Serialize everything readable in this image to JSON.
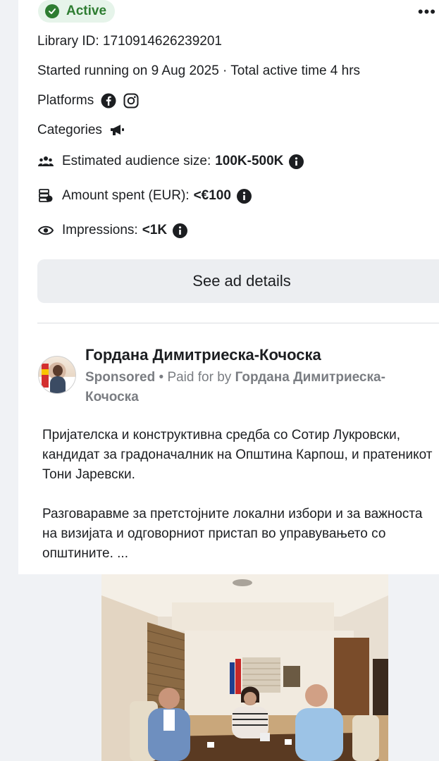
{
  "ad": {
    "status": "Active",
    "library_id": "Library ID: 1710914626239201",
    "running": "Started running on 9 Aug 2025 · Total active time 4 hrs",
    "platforms_label": "Platforms",
    "platforms": [
      "facebook-icon",
      "instagram-icon"
    ],
    "categories_label": "Categories",
    "categories": [
      "megaphone-icon"
    ],
    "audience_label": "Estimated audience size:",
    "audience_value": "100K-500K",
    "spent_label": "Amount spent (EUR):",
    "spent_value": "<€100",
    "impressions_label": "Impressions:",
    "impressions_value": "<1K",
    "see_details": "See ad details"
  },
  "post": {
    "advertiser": "Гордана Димитриеска-Кочоска",
    "sponsored": "Sponsored",
    "paid_for_by": " • Paid for by ",
    "payer": "Гордана Димитриеска-Кочоска",
    "paragraph1": "Пријателска и конструктивна  средба со Сотир Лукровски, кандидат за градоначалник на Општина Карпош, и пратеникот Тони Јаревски.",
    "paragraph2": "Разговаравме за претстојните локални избори и за важноста на визијата и одговорниот пристап во управувањето со општините. ..."
  },
  "colors": {
    "active_green": "#2e7d32",
    "badge_bg": "#e6f4ea",
    "button_bg": "#eceef1",
    "muted_text": "#7a7d82"
  }
}
